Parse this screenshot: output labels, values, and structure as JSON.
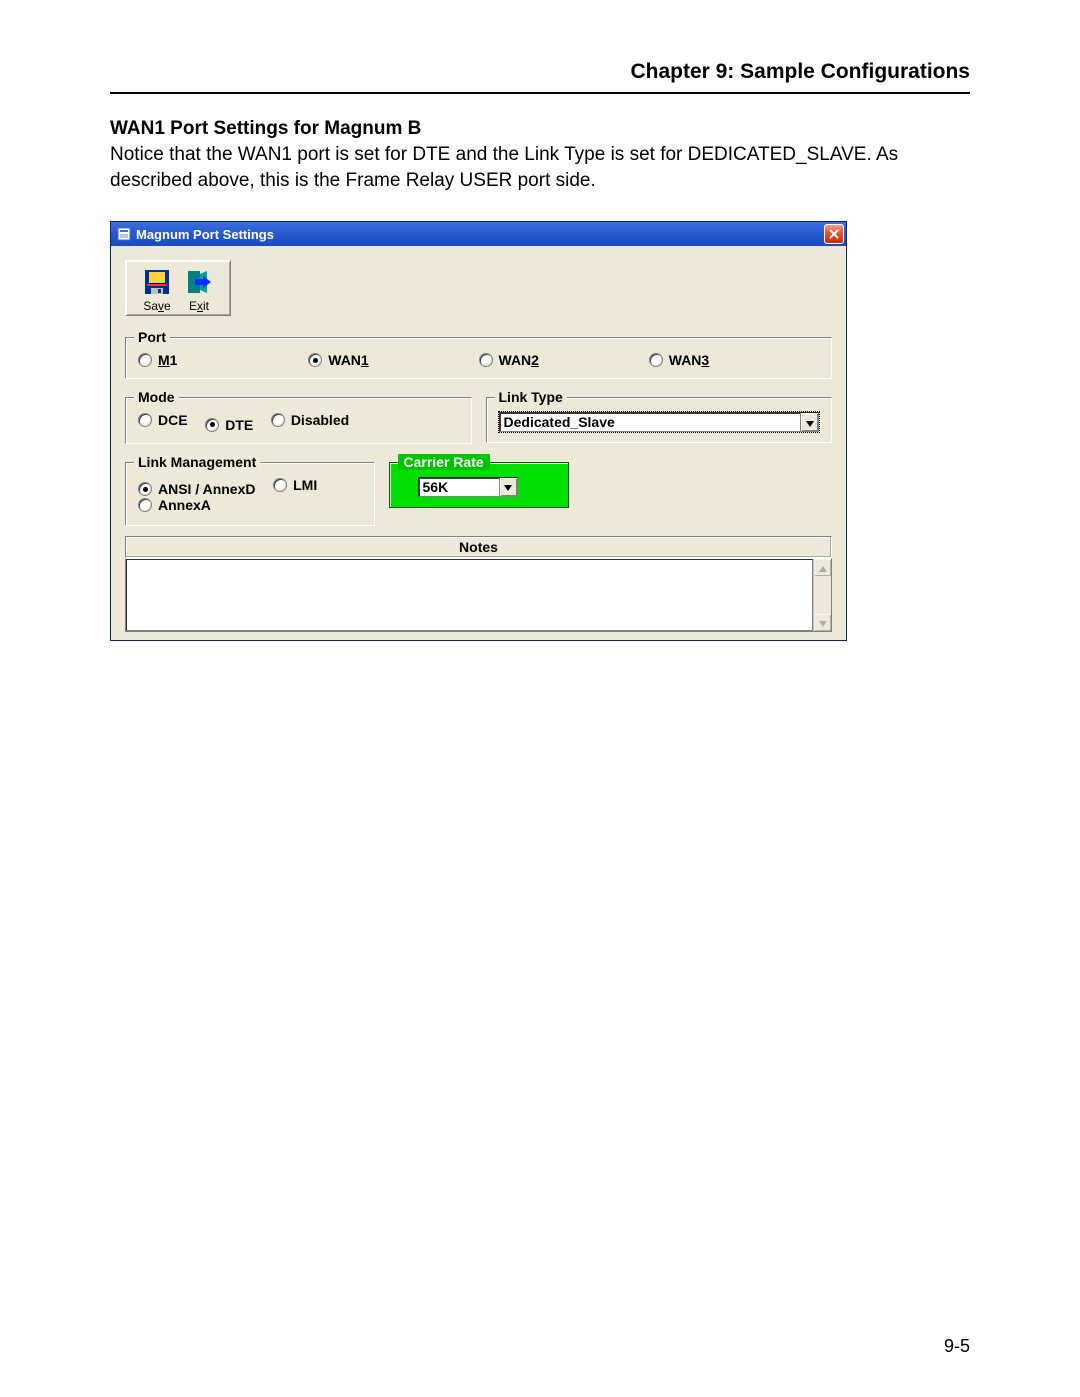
{
  "header": {
    "chapter_title": "Chapter 9: Sample Configurations"
  },
  "section": {
    "heading": "WAN1 Port Settings for Magnum B",
    "body": "Notice that the WAN1 port is set for DTE and the Link Type is set for DEDICATED_SLAVE.  As described above, this is the Frame Relay USER port side."
  },
  "footer": {
    "page_num": "9-5"
  },
  "dialog": {
    "title": "Magnum Port Settings",
    "toolbar": {
      "save_label": "Save",
      "exit_label": "Exit"
    },
    "port_group": {
      "legend": "Port",
      "options": {
        "m1": "M1",
        "wan1": "WAN1",
        "wan2": "WAN2",
        "wan3": "WAN3"
      },
      "selected": "wan1"
    },
    "mode_group": {
      "legend": "Mode",
      "options": {
        "dce": "DCE",
        "dte": "DTE",
        "disabled": "Disabled"
      },
      "selected": "dte"
    },
    "linktype_group": {
      "legend": "Link Type",
      "value": "Dedicated_Slave"
    },
    "linkmgmt_group": {
      "legend": "Link Management",
      "options": {
        "ansi": "ANSI / AnnexD",
        "lmi": "LMI",
        "annexa": "AnnexA"
      },
      "selected": "ansi"
    },
    "carrier_group": {
      "legend": "Carrier Rate",
      "value": "56K"
    },
    "notes": {
      "legend": "Notes",
      "text": ""
    }
  }
}
